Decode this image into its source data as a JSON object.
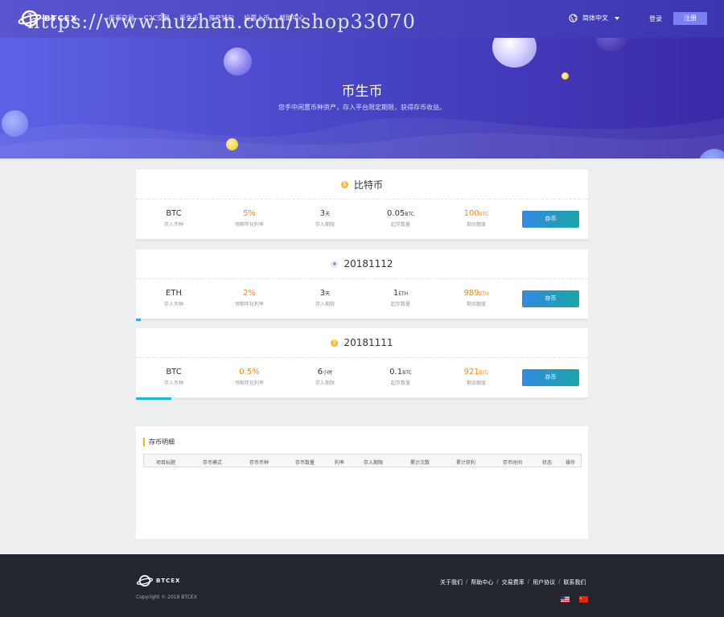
{
  "header": {
    "brand": "BTCEX",
    "nav": [
      "币币交易",
      "C2C交易",
      "币生币",
      "资产钱包",
      "投票上币",
      "帮助中心"
    ],
    "language": "简体中文",
    "login": "登录",
    "register": "注册"
  },
  "watermark": "https://www.huzhan.com/ishop33070",
  "hero": {
    "title": "币生币",
    "subtitle": "您手中闲置币种资产，存入平台限定期限，获得存币收益。"
  },
  "products": [
    {
      "title": "比特币",
      "coin_icon": "bitcoin-icon",
      "currency": "BTC",
      "currency_label": "存入币种",
      "rate": "5%",
      "rate_label": "预期年化利率",
      "period": "3",
      "period_unit": "天",
      "period_label": "存入期限",
      "min": "0.05",
      "min_unit": "BTC",
      "min_label": "起存数量",
      "remaining": "100",
      "remaining_unit": "BTC",
      "remaining_label": "剩余额度",
      "button": "存币",
      "progress": 0
    },
    {
      "title": "20181112",
      "coin_icon": "ethereum-icon",
      "currency": "ETH",
      "currency_label": "存入币种",
      "rate": "2%",
      "rate_label": "预期年化利率",
      "period": "3",
      "period_unit": "天",
      "period_label": "存入期限",
      "min": "1",
      "min_unit": "ETH",
      "min_label": "起存数量",
      "remaining": "989",
      "remaining_unit": "ETH",
      "remaining_label": "剩余额度",
      "button": "存币",
      "progress": 0.011
    },
    {
      "title": "20181111",
      "coin_icon": "bitcoin-icon",
      "currency": "BTC",
      "currency_label": "存入币种",
      "rate": "0.5%",
      "rate_label": "预期年化利率",
      "period": "6",
      "period_unit": "小时",
      "period_label": "存入期限",
      "min": "0.1",
      "min_unit": "BTC",
      "min_label": "起存数量",
      "remaining": "921",
      "remaining_unit": "BTC",
      "remaining_label": "剩余额度",
      "button": "存币",
      "progress": 0.079
    }
  ],
  "details": {
    "title": "存币明细",
    "columns": [
      "项目标题",
      "存币模式",
      "存币币种",
      "存币数量",
      "利率",
      "存入期限",
      "累计次数",
      "累计获利",
      "存币时间",
      "状态",
      "操作"
    ]
  },
  "footer": {
    "brand": "BTCEX",
    "copyright": "Copyright © 2018 BTCEX",
    "links": [
      "关于我们",
      "帮助中心",
      "交易费率",
      "用户协议",
      "联系我们"
    ],
    "flags": [
      "us-flag-icon",
      "cn-flag-icon"
    ]
  },
  "colors": {
    "header": "#4a45c4",
    "accent_orange": "#f08a24",
    "button": "#2a94d0",
    "footer": "#23262e"
  }
}
